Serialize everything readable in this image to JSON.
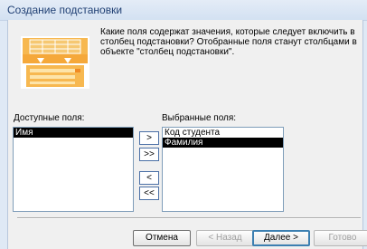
{
  "window": {
    "title": "Создание подстановки"
  },
  "intro": {
    "text": "Какие поля содержат значения, которые следует включить в столбец подстановки? Отобранные поля станут столбцами в объекте \"столбец подстановки\"."
  },
  "available": {
    "label": "Доступные поля:",
    "items": [
      {
        "label": "Имя",
        "selected": true
      }
    ]
  },
  "selected": {
    "label": "Выбранные поля:",
    "items": [
      {
        "label": "Код студента",
        "selected": false
      },
      {
        "label": "Фамилия",
        "selected": true
      }
    ]
  },
  "move_buttons": {
    "add": ">",
    "add_all": ">>",
    "remove": "<",
    "remove_all": "<<"
  },
  "footer": {
    "cancel": "Отмена",
    "back": "< Назад",
    "next": "Далее >",
    "finish": "Готово"
  }
}
